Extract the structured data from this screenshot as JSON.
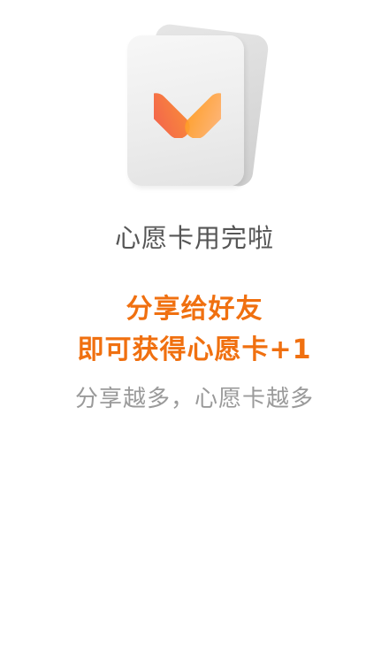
{
  "illustration": {
    "icon": "heart-card-icon",
    "colors": {
      "heart_left": "#f26d4f",
      "heart_right": "#ffa23a",
      "card": "#e8e8e8"
    }
  },
  "title": "心愿卡用完啦",
  "share_prompt": {
    "line1": "分享给好友",
    "line2": "即可获得心愿卡+1",
    "color": "#f07010"
  },
  "subtitle": "分享越多，心愿卡越多"
}
